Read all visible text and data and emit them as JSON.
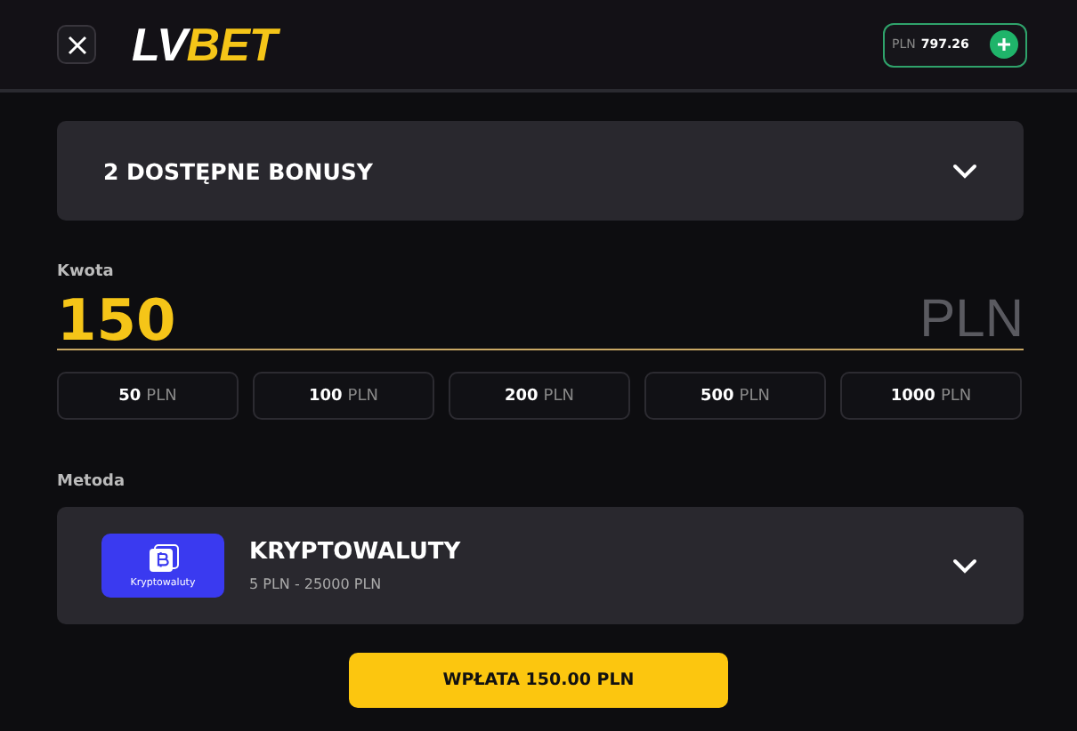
{
  "header": {
    "logo": {
      "first": "LV",
      "second": "BET"
    },
    "balance": {
      "currency": "PLN",
      "amount": "797.26"
    }
  },
  "bonuses": {
    "label": "2 DOSTĘPNE BONUSY",
    "expanded": false
  },
  "amount": {
    "label": "Kwota",
    "value": "150",
    "currency": "PLN"
  },
  "presets": [
    {
      "amount": "50",
      "currency": "PLN"
    },
    {
      "amount": "100",
      "currency": "PLN"
    },
    {
      "amount": "200",
      "currency": "PLN"
    },
    {
      "amount": "500",
      "currency": "PLN"
    },
    {
      "amount": "1000",
      "currency": "PLN"
    }
  ],
  "method": {
    "label": "Metoda",
    "badge": "Kryptowaluty",
    "name": "KRYPTOWALUTY",
    "range": "5 PLN - 25000 PLN",
    "expanded": false
  },
  "submit": {
    "label": "WPŁATA 150.00 PLN"
  }
}
